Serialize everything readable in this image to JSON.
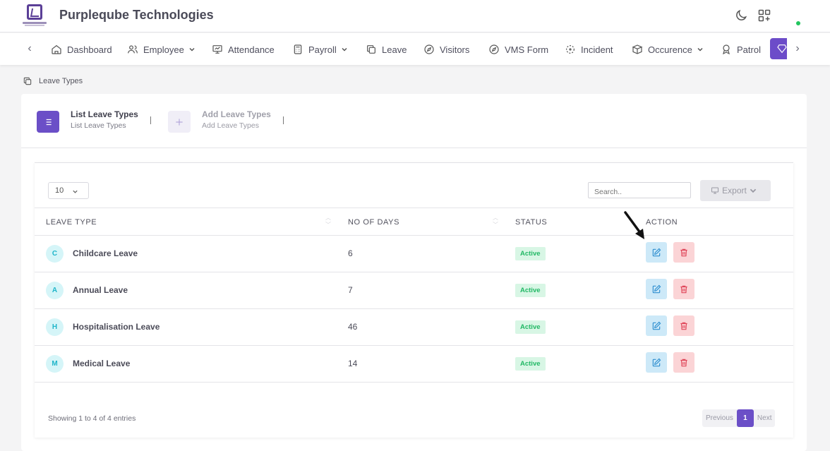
{
  "app": {
    "title": "Purpleqube Technologies"
  },
  "nav": {
    "items": [
      {
        "label": "Dashboard"
      },
      {
        "label": "Employee"
      },
      {
        "label": "Attendance"
      },
      {
        "label": "Payroll"
      },
      {
        "label": "Leave"
      },
      {
        "label": "Visitors"
      },
      {
        "label": "VMS Form"
      },
      {
        "label": "Incident"
      },
      {
        "label": "Occurence"
      },
      {
        "label": "Patrol"
      }
    ]
  },
  "breadcrumb": {
    "label": "Leave Types"
  },
  "tabs": [
    {
      "title": "List Leave Types",
      "subtitle": "List Leave Types"
    },
    {
      "title": "Add Leave Types",
      "subtitle": "Add Leave Types"
    }
  ],
  "table": {
    "page_length": "10",
    "search_placeholder": "Search..",
    "export_label": "Export",
    "headers": [
      "LEAVE TYPE",
      "NO OF DAYS",
      "STATUS",
      "ACTION"
    ],
    "rows": [
      {
        "initial": "C",
        "name": "Childcare Leave",
        "days": "6",
        "status": "Active"
      },
      {
        "initial": "A",
        "name": "Annual Leave",
        "days": "7",
        "status": "Active"
      },
      {
        "initial": "H",
        "name": "Hospitalisation Leave",
        "days": "46",
        "status": "Active"
      },
      {
        "initial": "M",
        "name": "Medical Leave",
        "days": "14",
        "status": "Active"
      }
    ],
    "info": "Showing 1 to 4 of 4 entries",
    "pagination": {
      "previous": "Previous",
      "current": "1",
      "next": "Next"
    }
  },
  "colors": {
    "primary": "#6b4fc7",
    "active_badge": "#22b865",
    "danger": "#e25563",
    "info": "#3b9ad6"
  }
}
